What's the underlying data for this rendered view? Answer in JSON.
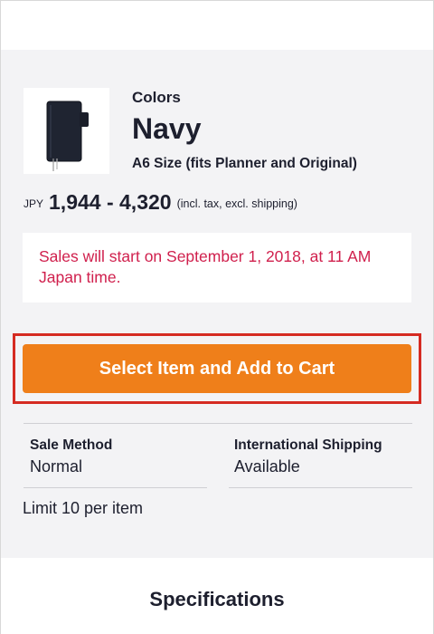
{
  "product": {
    "colors_label": "Colors",
    "color_name": "Navy",
    "size_note": "A6 Size (fits Planner and Original)",
    "currency": "JPY",
    "price_range": "1,944 - 4,320",
    "price_note": "(incl. tax, excl. shipping)",
    "thumbnail_icon": "notebook-cover-icon"
  },
  "notice": {
    "text": "Sales will start on September 1, 2018, at 11 AM Japan time.",
    "color": "#d0204d"
  },
  "cta": {
    "label": "Select Item and Add to Cart",
    "color": "#ef7f1a",
    "highlight_color": "#d52b22"
  },
  "details": {
    "sale_method_label": "Sale Method",
    "sale_method_value": "Normal",
    "shipping_label": "International Shipping",
    "shipping_value": "Available",
    "limit": "Limit 10 per item"
  },
  "specifications": {
    "title": "Specifications"
  }
}
